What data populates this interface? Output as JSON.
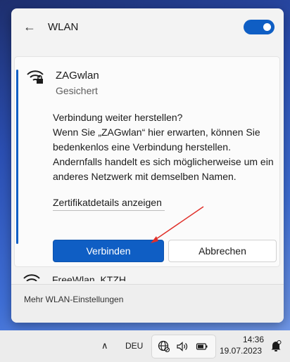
{
  "panel": {
    "title": "WLAN",
    "toggle_state": "on",
    "accent_color": "#0f5ec4"
  },
  "network": {
    "name": "ZAGwlan",
    "status": "Gesichert",
    "icon": "wifi-secured-icon",
    "question": "Verbindung weiter herstellen?",
    "message": "Wenn Sie „ZAGwlan“ hier erwarten, können Sie bedenkenlos eine Verbindung herstellen. Andernfalls handelt es sich möglicherweise um ein anderes Netzwerk mit demselben Namen.",
    "cert_link": "Zertifikatdetails anzeigen",
    "connect_label": "Verbinden",
    "cancel_label": "Abbrechen"
  },
  "next_network": {
    "name": "FreeWlan_KTZH",
    "icon": "wifi-icon"
  },
  "footer": {
    "settings_link": "Mehr WLAN-Einstellungen"
  },
  "taskbar": {
    "chevron_icon": "chevron-up-icon",
    "language": "DEU",
    "tray_icons": [
      "globe-network-icon",
      "speaker-icon",
      "battery-icon"
    ],
    "time": "14:36",
    "date": "19.07.2023",
    "notification_icon": "notification-bell-icon"
  },
  "annotation": {
    "arrow_color": "#e0302a"
  }
}
